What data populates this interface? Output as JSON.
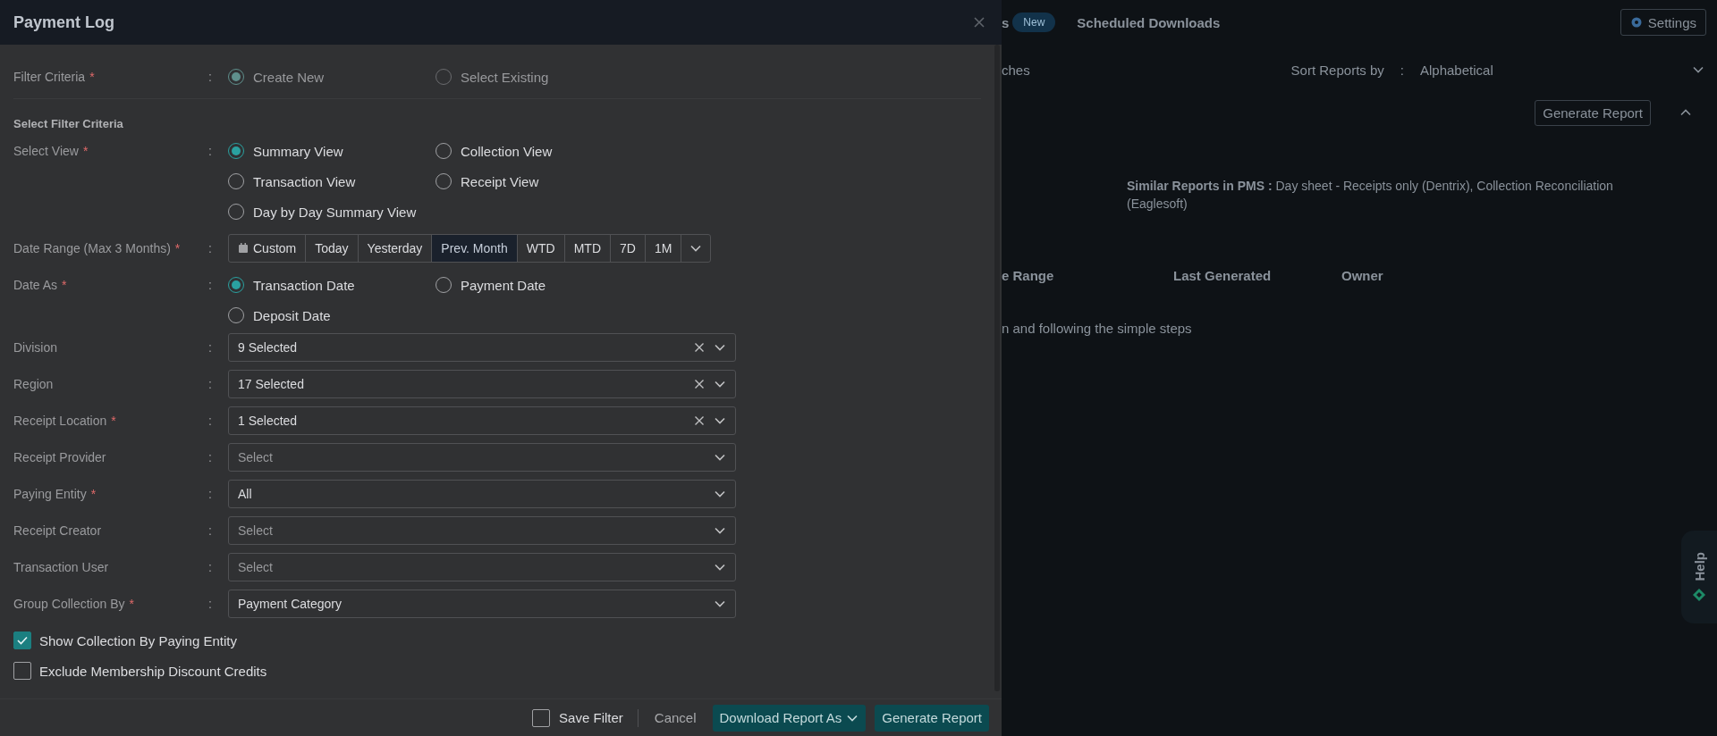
{
  "dialog": {
    "title": "Payment Log",
    "fields": [
      {
        "kind": "radio",
        "label": "Filter Criteria",
        "required_mark": "*",
        "colon": ":",
        "disabled": true,
        "options": [
          {
            "label": "Create New",
            "selected": true
          },
          {
            "label": "Select Existing",
            "selected": false
          }
        ]
      },
      {
        "kind": "heading",
        "label": "Select Filter Criteria"
      },
      {
        "kind": "radio",
        "label": "Select View",
        "required_mark": "*",
        "colon": ":",
        "disabled": false,
        "options": [
          {
            "label": "Summary View",
            "selected": true
          },
          {
            "label": "Collection View",
            "selected": false
          },
          {
            "label": "Transaction View",
            "selected": false
          },
          {
            "label": "Receipt View",
            "selected": false
          },
          {
            "label": "Day by Day Summary View",
            "selected": false
          }
        ]
      },
      {
        "kind": "segmented",
        "label": "Date Range (Max 3 Months)",
        "required_mark": "*",
        "colon": ":",
        "options": [
          {
            "label": "Custom",
            "kind": "custom",
            "selected": false
          },
          {
            "label": "Today",
            "kind": "preset",
            "selected": false
          },
          {
            "label": "Yesterday",
            "kind": "preset",
            "selected": false
          },
          {
            "label": "Prev. Month",
            "kind": "preset",
            "selected": true
          },
          {
            "label": "WTD",
            "kind": "preset",
            "selected": false
          },
          {
            "label": "MTD",
            "kind": "preset",
            "selected": false
          },
          {
            "label": "7D",
            "kind": "preset",
            "selected": false
          },
          {
            "label": "1M",
            "kind": "preset",
            "selected": false
          }
        ]
      },
      {
        "kind": "radio",
        "label": "Date As",
        "required_mark": "*",
        "colon": ":",
        "disabled": false,
        "options": [
          {
            "label": "Transaction Date",
            "selected": true
          },
          {
            "label": "Payment Date",
            "selected": false
          },
          {
            "label": "Deposit Date",
            "selected": false
          }
        ]
      },
      {
        "kind": "select",
        "label": "Division",
        "colon": ":",
        "value": "9 Selected",
        "clearable": true
      },
      {
        "kind": "select",
        "label": "Region",
        "colon": ":",
        "value": "17 Selected",
        "clearable": true
      },
      {
        "kind": "select",
        "label": "Receipt Location",
        "required_mark": "*",
        "colon": ":",
        "value": "1 Selected",
        "clearable": true
      },
      {
        "kind": "select",
        "label": "Receipt Provider",
        "colon": ":",
        "placeholder": "Select",
        "clearable": false
      },
      {
        "kind": "select",
        "label": "Paying Entity",
        "required_mark": "*",
        "colon": ":",
        "value": "All",
        "clearable": false
      },
      {
        "kind": "select",
        "label": "Receipt Creator",
        "colon": ":",
        "placeholder": "Select",
        "clearable": false
      },
      {
        "kind": "select",
        "label": "Transaction User",
        "colon": ":",
        "placeholder": "Select",
        "clearable": false
      },
      {
        "kind": "select",
        "label": "Group Collection By",
        "required_mark": "*",
        "colon": ":",
        "value": "Payment Category",
        "clearable": false
      },
      {
        "kind": "checkbox",
        "label": "Show Collection By Paying Entity",
        "checked": true
      },
      {
        "kind": "checkbox",
        "label": "Exclude Membership Discount Credits",
        "checked": false
      }
    ],
    "footer": {
      "save_filter": {
        "label": "Save Filter",
        "checked": false
      },
      "cancel": "Cancel",
      "download": "Download Report As",
      "generate": "Generate Report"
    }
  },
  "background_page": {
    "tab_fragment": "s",
    "new_badge": "New",
    "scheduled_tab": "Scheduled Downloads",
    "settings_button": "Settings",
    "search_fragment": "ches",
    "sort_label": "Sort Reports by",
    "sort_colon": ":",
    "sort_value": "Alphabetical",
    "generate_button": "Generate Report",
    "similar_reports": "**Similar Reports in PMS :** Day sheet - Receipts only (Dentrix), Collection Reconciliation (Eaglesoft)",
    "columns": [
      "e Range",
      "Last Generated",
      "Owner"
    ],
    "empty_message": "n and following the simple steps",
    "help": "Help"
  }
}
